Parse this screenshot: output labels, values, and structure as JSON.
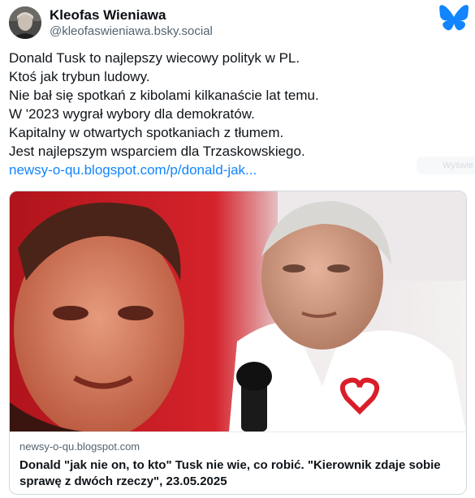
{
  "author": {
    "display_name": "Kleofas Wieniawa",
    "handle": "@kleofaswieniawa.bsky.social"
  },
  "post": {
    "lines": [
      "Donald Tusk to najlepszy wiecowy polityk w PL.",
      "Ktoś jak trybun ludowy.",
      "Nie bał się spotkań z kibolami kilkanaście lat temu.",
      "W '2023 wygrał wybory dla demokratów.",
      "Kapitalny w otwartych spotkaniach z tłumem.",
      "Jest najlepszym wsparciem dla Trzaskowskiego."
    ],
    "link_text": "newsy-o-qu.blogspot.com/p/donald-jak..."
  },
  "ghost_chip": {
    "label": "Wyświe"
  },
  "embed": {
    "domain": "newsy-o-qu.blogspot.com",
    "title": "Donald \"jak nie on, to kto\" Tusk nie wie, co robić. \"Kierownik zdaje sobie sprawę z dwóch rzeczy\", 23.05.2025"
  },
  "colors": {
    "brand": "#1185fe",
    "text": "#0f1419",
    "muted": "#536471",
    "border": "#cfd9de"
  },
  "icons": {
    "platform": "bluesky-butterfly-icon"
  }
}
